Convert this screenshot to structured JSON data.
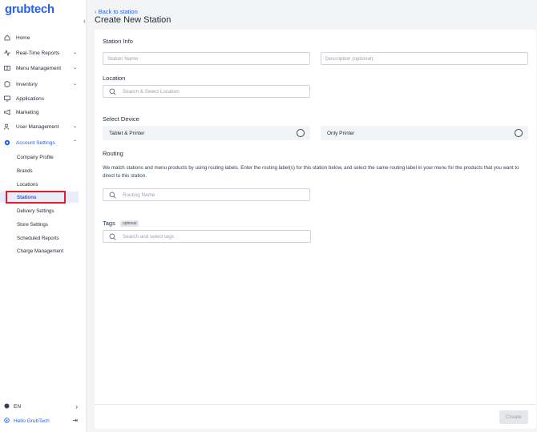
{
  "brand": {
    "logo_text": "grubtech",
    "accent_color": "#2563eb"
  },
  "sidebar": {
    "collapse_icon": "chevron-left-icon",
    "items": [
      {
        "label": "Home",
        "icon": "home-icon"
      },
      {
        "label": "Real-Time Reports",
        "icon": "pulse-icon",
        "chevron": "⌄"
      },
      {
        "label": "Menu Management",
        "icon": "book-icon",
        "chevron": "⌄"
      },
      {
        "label": "Inventory",
        "icon": "box-icon",
        "chevron": "⌄"
      },
      {
        "label": "Applications",
        "icon": "monitor-icon"
      },
      {
        "label": "Marketing",
        "icon": "megaphone-icon"
      },
      {
        "label": "User Management",
        "icon": "users-icon",
        "chevron": "⌄"
      },
      {
        "label": "Account Settings",
        "icon": "gear-icon",
        "chevron": "⌃"
      }
    ],
    "sub_items": [
      {
        "label": "Company Profile"
      },
      {
        "label": "Brands"
      },
      {
        "label": "Locations"
      },
      {
        "label": "Stations"
      },
      {
        "label": "Delivery Settings"
      },
      {
        "label": "Store Settings"
      },
      {
        "label": "Scheduled Reports"
      },
      {
        "label": "Charge Management"
      }
    ],
    "language": {
      "label": "EN",
      "arrow": "›"
    },
    "user": {
      "greeting": "Hello GrubTech",
      "logout": "⇥"
    }
  },
  "header": {
    "back_label": "‹ Back to station",
    "title": "Create New Station"
  },
  "form": {
    "station_info": {
      "title": "Station Info",
      "name_placeholder": "Station Name",
      "description_placeholder": "Description (optional)"
    },
    "location": {
      "title": "Location",
      "placeholder": "Search & Select Location"
    },
    "device": {
      "title": "Select Device",
      "options": [
        {
          "label": "Tablet & Printer"
        },
        {
          "label": "Only Printer"
        }
      ]
    },
    "routing": {
      "title": "Routing",
      "description": "We match stations and menu products by using routing labels. Enter the routing label(s) for this station below, and select the same routing label in your menu for the products that you want to direct to this station.",
      "placeholder": "Routing Name"
    },
    "tags": {
      "title": "Tags",
      "badge": "optional",
      "placeholder": "Search and select tags"
    },
    "create_label": "Create"
  }
}
